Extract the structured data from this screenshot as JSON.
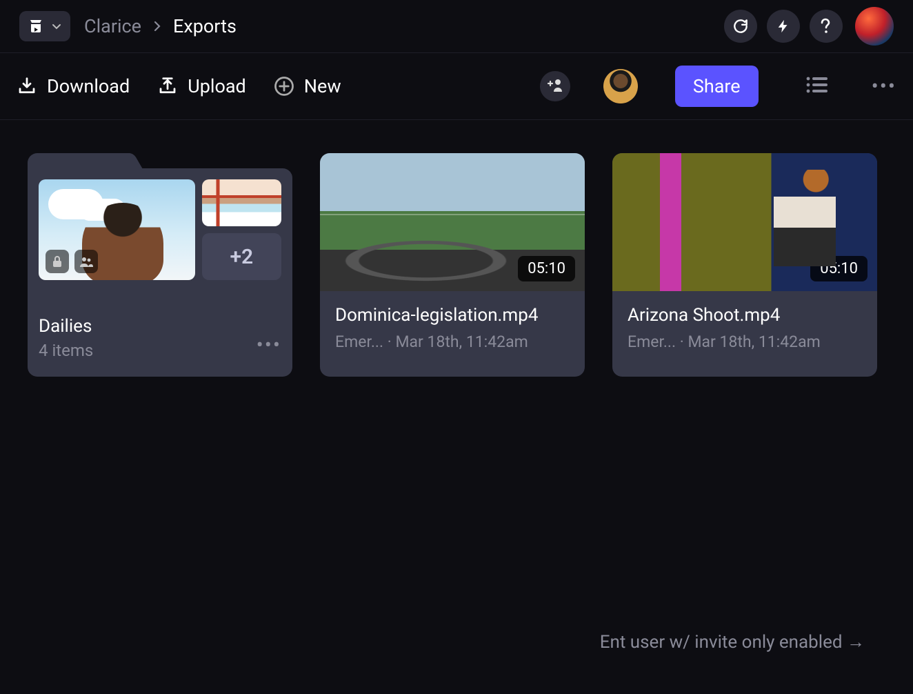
{
  "breadcrumb": {
    "parent": "Clarice",
    "current": "Exports"
  },
  "toolbar": {
    "download": "Download",
    "upload": "Upload",
    "new": "New",
    "share": "Share"
  },
  "folder": {
    "name": "Dailies",
    "subtitle": "4 items",
    "overflow_count": "+2"
  },
  "videos": [
    {
      "title": "Dominica-legislation.mp4",
      "author": "Emer...",
      "timestamp": "Mar 18th, 11:42am",
      "duration": "05:10"
    },
    {
      "title": "Arizona Shoot.mp4",
      "author": "Emer...",
      "timestamp": "Mar 18th, 11:42am",
      "duration": "05:10"
    }
  ],
  "footer_note": "Ent user w/ invite only enabled →"
}
